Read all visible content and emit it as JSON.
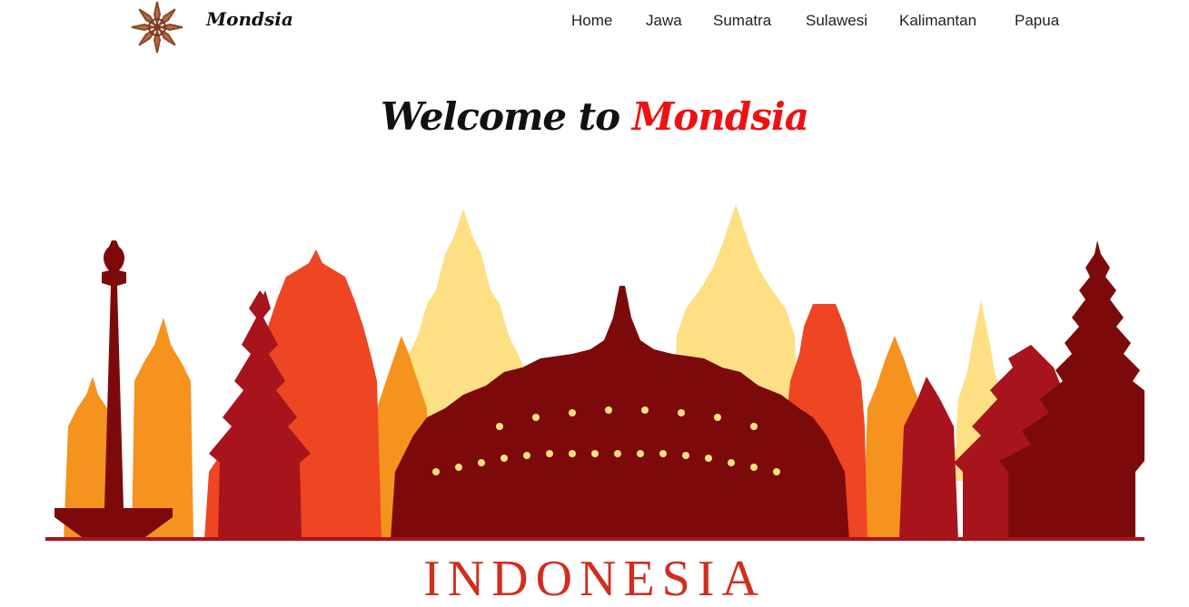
{
  "brand": {
    "name": "Mondsia",
    "logo_icon": "star-ornament-icon"
  },
  "nav": {
    "items": [
      {
        "label": "Home"
      },
      {
        "label": "Jawa"
      },
      {
        "label": "Sumatra"
      },
      {
        "label": "Sulawesi"
      },
      {
        "label": "Kalimantan"
      },
      {
        "label": "Papua"
      }
    ]
  },
  "hero": {
    "title_prefix": "Welcome to",
    "title_accent": "Mondsia",
    "illustration_icon": "indonesia-landmarks-skyline-icon",
    "caption": "INDONESIA"
  },
  "colors": {
    "accent_red": "#ee1111",
    "maroon": "#7d0a0a",
    "deep_red": "#a8141c",
    "red_orange": "#ee4523",
    "orange": "#f6921e",
    "pale_yellow": "#fde084",
    "caption_red": "#d22d1e",
    "logo_brown": "#8b4a2b"
  }
}
